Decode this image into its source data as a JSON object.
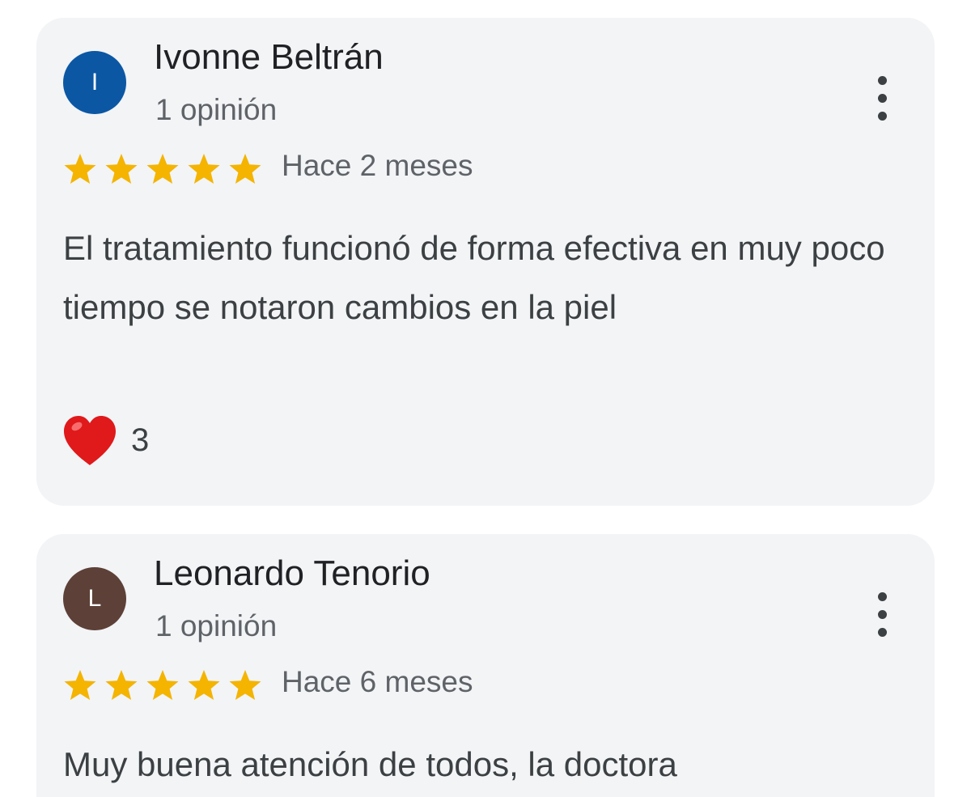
{
  "reviews": [
    {
      "initial": "I",
      "avatar_color": "#0b57a4",
      "name": "Ivonne Beltrán",
      "review_count": "1 opinión",
      "rating": 5,
      "date": "Hace 2 meses",
      "text": "El tratamiento funcionó de forma efectiva en muy poco tiempo se notaron cambios en la piel",
      "reaction_icon": "red-heart",
      "reaction_count": "3",
      "menu_icon": "more-vert-icon"
    },
    {
      "initial": "L",
      "avatar_color": "#5d4037",
      "name": "Leonardo Tenorio",
      "review_count": "1 opinión",
      "rating": 5,
      "date": "Hace 6 meses",
      "text": "Muy buena atención de todos, la doctora",
      "menu_icon": "more-vert-icon"
    }
  ],
  "colors": {
    "star": "#f4b400",
    "card_background": "#f2f4f6",
    "heart": "#e0191b"
  }
}
